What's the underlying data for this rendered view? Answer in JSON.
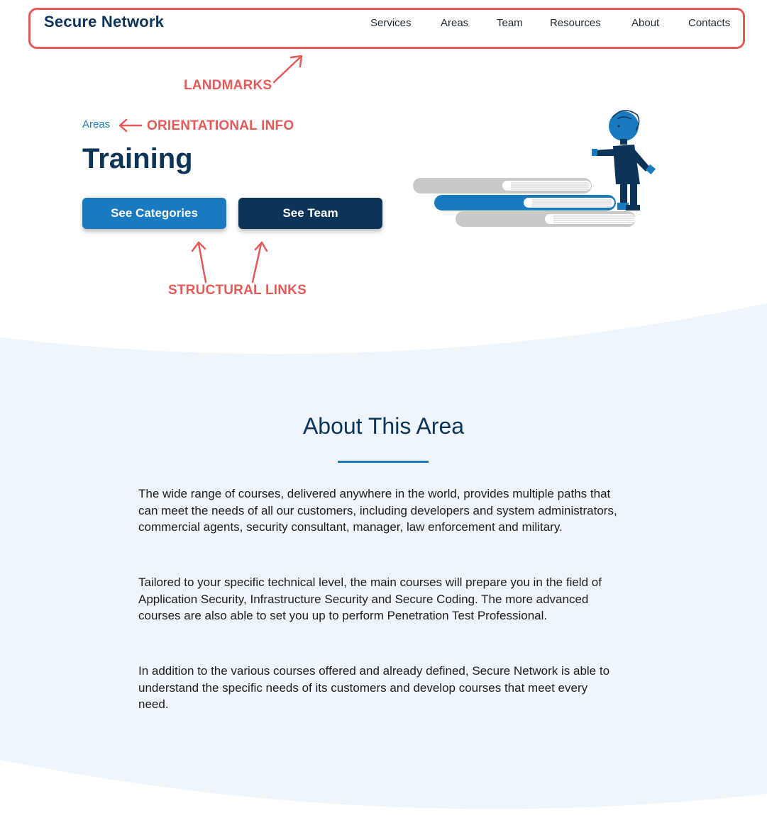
{
  "header": {
    "logo": "Secure Network",
    "nav": [
      "Services",
      "Areas",
      "Team",
      "Resources",
      "About",
      "Contacts"
    ]
  },
  "annotations": {
    "landmarks": "LANDMARKS",
    "orientational": "ORIENTATIONAL INFO",
    "structural": "STRUCTURAL LINKS"
  },
  "hero": {
    "breadcrumb": "Areas",
    "title": "Training",
    "buttons": {
      "primary": "See Categories",
      "secondary": "See Team"
    }
  },
  "about": {
    "title": "About This Area",
    "paragraphs": [
      "The wide range of courses, delivered anywhere in the world, provides multiple paths that can meet the needs of all our customers, including developers and system administrators, commercial agents, security consultant, manager, law enforcement and military.",
      "Tailored to your specific technical level, the main courses will prepare you in the field of Application Security, Infrastructure Security and Secure Coding. The more advanced courses are also able to set you up to perform Penetration Test Professional.",
      "In addition to the various courses offered and already defined, Secure Network is able to understand the specific needs of its customers and develop courses that meet every need."
    ]
  },
  "colors": {
    "brand_dark": "#0c3358",
    "brand_blue": "#1a7abf",
    "annotation_red": "#e35a59",
    "section_bg": "#eef6fc"
  }
}
